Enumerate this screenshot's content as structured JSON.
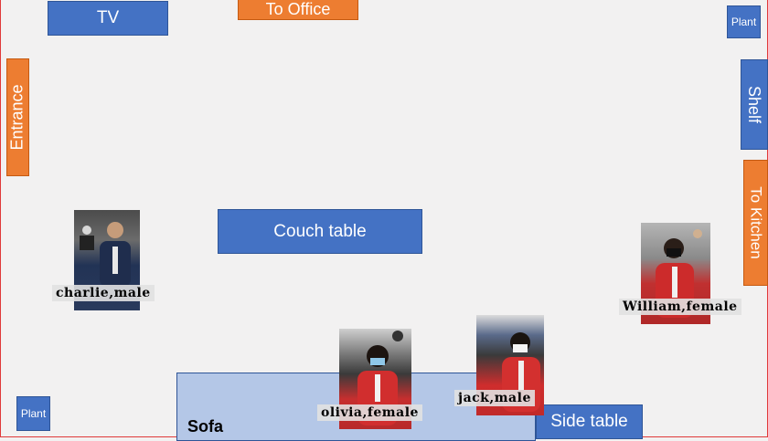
{
  "furniture": {
    "tv": "TV",
    "to_office": "To Office",
    "plant_top": "Plant",
    "entrance": "Entrance",
    "shelf": "Shelf",
    "to_kitchen": "To Kitchen",
    "couch_table": "Couch table",
    "plant_bottom": "Plant",
    "sofa": "Sofa",
    "side_table": "Side table"
  },
  "people": [
    {
      "label": "charlie,male"
    },
    {
      "label": "William,female"
    },
    {
      "label": "olivia,female"
    },
    {
      "label": "jack,male"
    }
  ],
  "colors": {
    "furniture_blue": "#4472c4",
    "door_orange": "#ed7d31",
    "sofa_light_blue": "#b4c7e7",
    "background": "#f2f1f1",
    "border_red": "#e03a3a"
  }
}
